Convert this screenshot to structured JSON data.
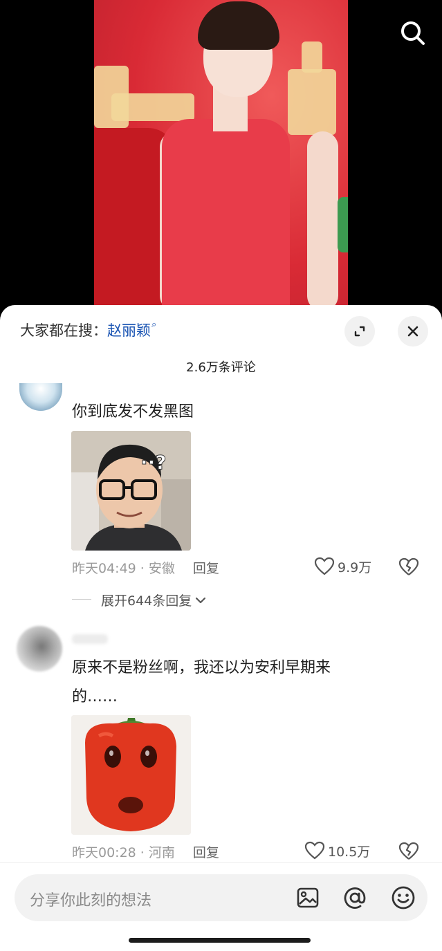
{
  "hot_search": {
    "prefix": "大家都在搜：",
    "keyword": "赵丽颖"
  },
  "comment_count": "2.6万条评论",
  "comments": [
    {
      "text": "你到底发不发黑图",
      "time_location": "昨天04:49 · 安徽",
      "reply_label": "回复",
      "likes": "9.9万",
      "expand_label": "展开644条回复"
    },
    {
      "text_line1": "原来不是粉丝啊，我还以为安利早期来",
      "text_line2": "的……",
      "time_location": "昨天00:28 · 河南",
      "reply_label": "回复",
      "likes": "10.5万"
    }
  ],
  "input": {
    "placeholder": "分享你此刻的想法"
  },
  "icons": [
    "search-icon",
    "expand-icon",
    "close-icon",
    "heart-icon",
    "broken-heart-icon",
    "chevron-down-icon",
    "image-icon",
    "at-icon",
    "emoji-icon"
  ],
  "colors": {
    "keyword": "#1a54b3",
    "sheet_bg": "#ffffff",
    "video_bg": "#000000"
  }
}
